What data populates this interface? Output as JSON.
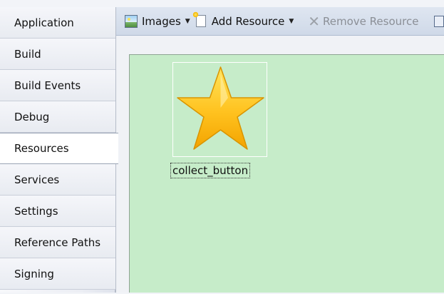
{
  "sidebar": {
    "items": [
      {
        "label": "Application"
      },
      {
        "label": "Build"
      },
      {
        "label": "Build Events"
      },
      {
        "label": "Debug"
      },
      {
        "label": "Resources",
        "selected": true
      },
      {
        "label": "Services"
      },
      {
        "label": "Settings"
      },
      {
        "label": "Reference Paths"
      },
      {
        "label": "Signing"
      }
    ]
  },
  "toolbar": {
    "images_label": "Images",
    "add_resource_label": "Add Resource",
    "remove_resource_label": "Remove Resource"
  },
  "resources": [
    {
      "name": "collect_button",
      "icon": "star-icon"
    }
  ],
  "colors": {
    "canvas_bg": "#c6ecc9",
    "star_fill_top": "#ffe45c",
    "star_fill_bottom": "#f3a300"
  }
}
